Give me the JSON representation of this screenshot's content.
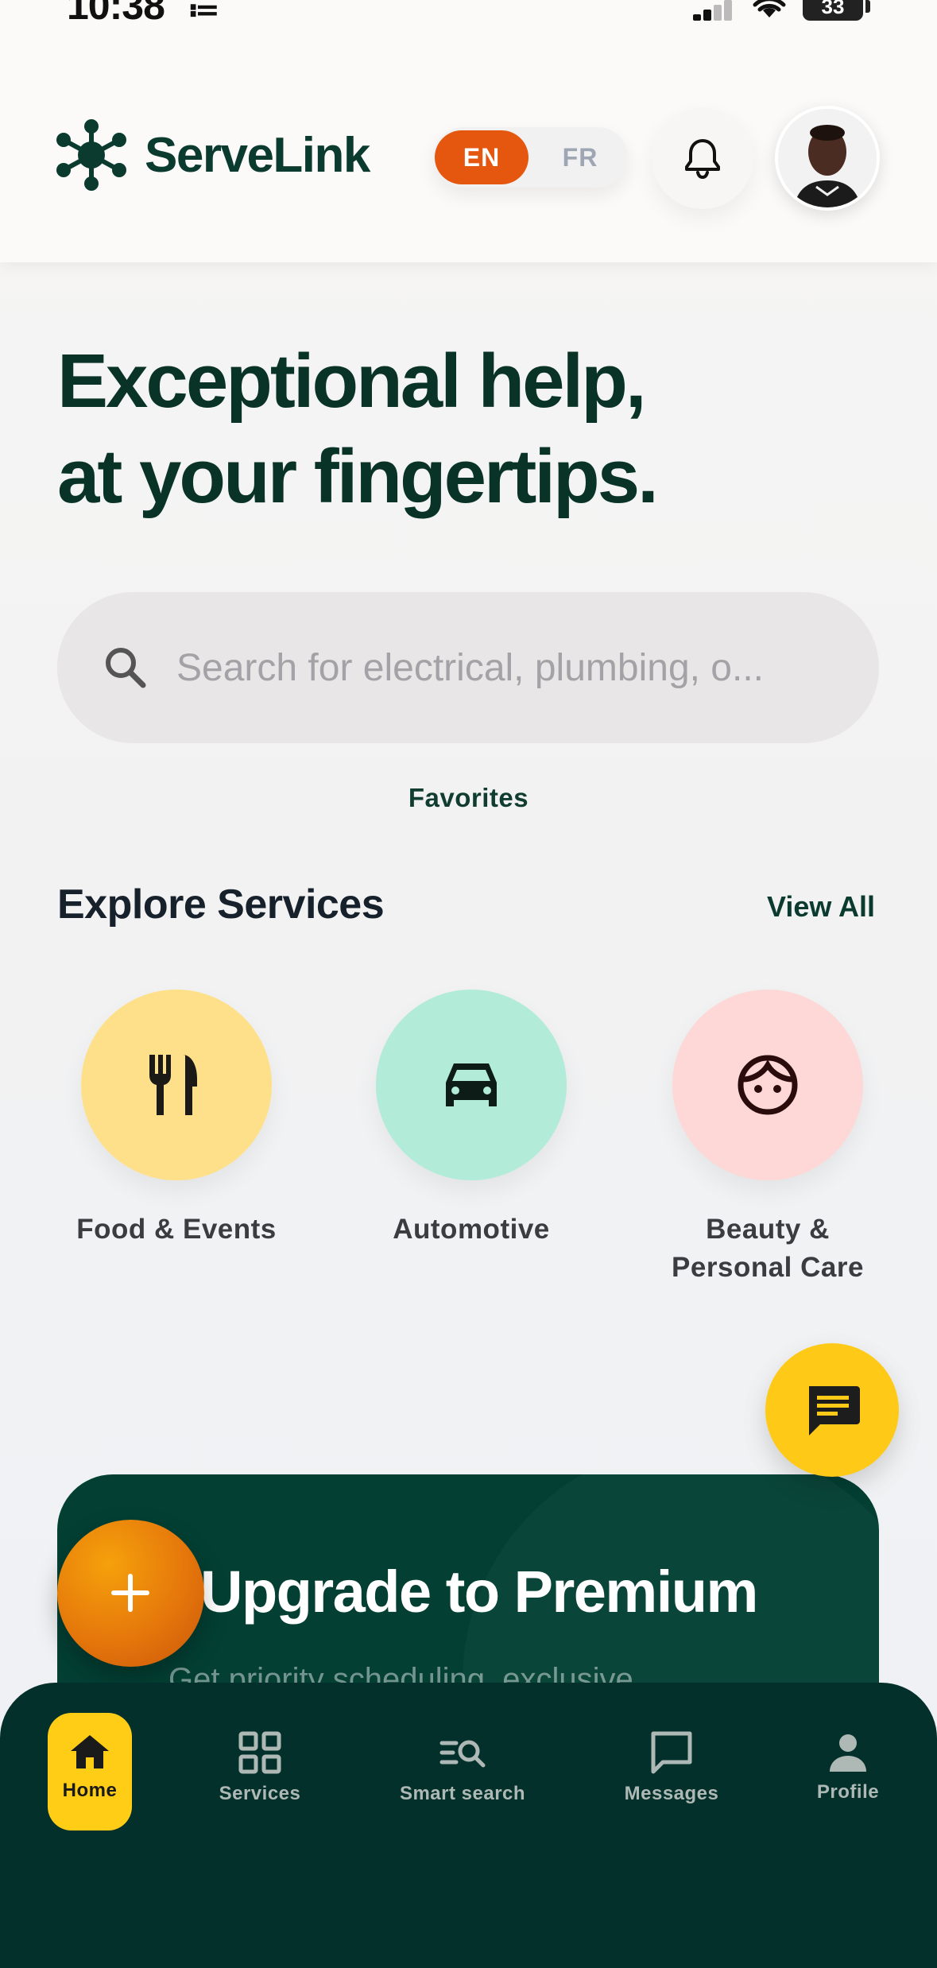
{
  "status_bar": {
    "time": "10:38",
    "time_glyph": "≔",
    "battery": "33"
  },
  "header": {
    "brand": "ServeLink",
    "lang_active": "EN",
    "lang_inactive": "FR"
  },
  "hero": {
    "title_line1": "Exceptional help,",
    "title_line2": "at your fingertips."
  },
  "search": {
    "placeholder": "Search for electrical, plumbing, o..."
  },
  "favorites_label": "Favorites",
  "explore": {
    "title": "Explore Services",
    "view_all": "View All",
    "services": [
      {
        "label_line1": "Food & Events",
        "label_line2": "",
        "icon": "utensils-icon",
        "color": "#ffe08a"
      },
      {
        "label_line1": "Automotive",
        "label_line2": "",
        "icon": "car-icon",
        "color": "#b2ecd8"
      },
      {
        "label_line1": "Beauty &",
        "label_line2": "Personal Care",
        "icon": "face-icon",
        "color": "#fdd8d6"
      }
    ]
  },
  "premium": {
    "title": "Upgrade to Premium",
    "subtitle": "Get priority scheduling, exclusive ..."
  },
  "bottom_nav": {
    "items": [
      {
        "label": "Home",
        "icon": "home-icon",
        "active": true
      },
      {
        "label": "Services",
        "icon": "grid-icon",
        "active": false
      },
      {
        "label": "Smart search",
        "icon": "smart-search-icon",
        "active": false
      },
      {
        "label": "Messages",
        "icon": "message-icon",
        "active": false
      },
      {
        "label": "Profile",
        "icon": "person-icon",
        "active": false
      }
    ]
  },
  "colors": {
    "brand_green": "#0b3a2e",
    "accent_orange": "#e5570e",
    "accent_yellow": "#ffcd16",
    "nav_bg": "#03302a"
  }
}
